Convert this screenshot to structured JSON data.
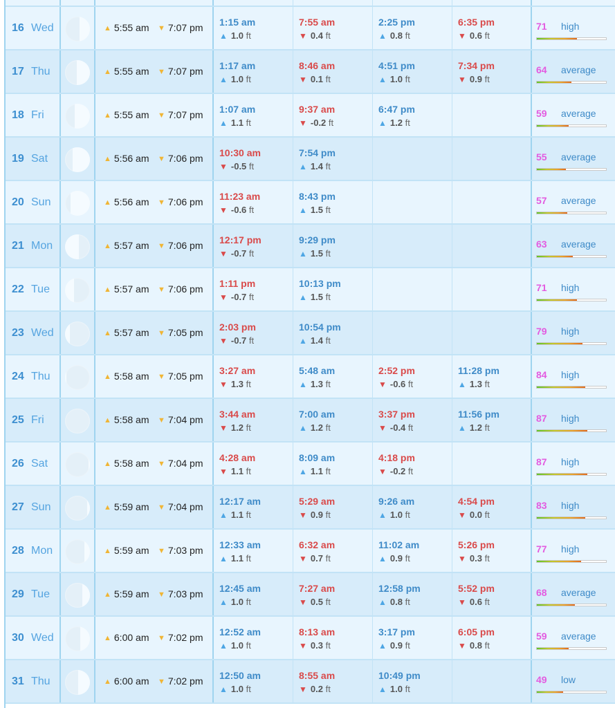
{
  "units": {
    "height": "ft"
  },
  "rows": [
    {
      "day_num": "16",
      "day_name": "Wed",
      "moon_lit": 0.42,
      "moon_side": "right",
      "sunrise": "5:55 am",
      "sunset": "7:07 pm",
      "tides": [
        {
          "time": "1:15 am",
          "type": "high",
          "height": "1.0"
        },
        {
          "time": "7:55 am",
          "type": "low",
          "height": "0.4"
        },
        {
          "time": "2:25 pm",
          "type": "high",
          "height": "0.8"
        },
        {
          "time": "6:35 pm",
          "type": "low",
          "height": "0.6"
        }
      ],
      "coef": "71",
      "coef_label": "high",
      "coef_level": 0.58
    },
    {
      "day_num": "17",
      "day_name": "Thu",
      "moon_lit": 0.52,
      "moon_side": "right",
      "sunrise": "5:55 am",
      "sunset": "7:07 pm",
      "tides": [
        {
          "time": "1:17 am",
          "type": "high",
          "height": "1.0"
        },
        {
          "time": "8:46 am",
          "type": "low",
          "height": "0.1"
        },
        {
          "time": "4:51 pm",
          "type": "high",
          "height": "1.0"
        },
        {
          "time": "7:34 pm",
          "type": "low",
          "height": "0.9"
        }
      ],
      "coef": "64",
      "coef_label": "average",
      "coef_level": 0.5
    },
    {
      "day_num": "18",
      "day_name": "Fri",
      "moon_lit": 0.6,
      "moon_side": "right",
      "sunrise": "5:55 am",
      "sunset": "7:07 pm",
      "tides": [
        {
          "time": "1:07 am",
          "type": "high",
          "height": "1.1"
        },
        {
          "time": "9:37 am",
          "type": "low",
          "height": "-0.2"
        },
        {
          "time": "6:47 pm",
          "type": "high",
          "height": "1.2"
        }
      ],
      "coef": "59",
      "coef_label": "average",
      "coef_level": 0.46
    },
    {
      "day_num": "19",
      "day_name": "Sat",
      "moon_lit": 0.7,
      "moon_side": "right",
      "sunrise": "5:56 am",
      "sunset": "7:06 pm",
      "tides": [
        {
          "time": "10:30 am",
          "type": "low",
          "height": "-0.5"
        },
        {
          "time": "7:54 pm",
          "type": "high",
          "height": "1.4"
        }
      ],
      "coef": "55",
      "coef_label": "average",
      "coef_level": 0.42
    },
    {
      "day_num": "20",
      "day_name": "Sun",
      "moon_lit": 0.78,
      "moon_side": "right",
      "sunrise": "5:56 am",
      "sunset": "7:06 pm",
      "tides": [
        {
          "time": "11:23 am",
          "type": "low",
          "height": "-0.6"
        },
        {
          "time": "8:43 pm",
          "type": "high",
          "height": "1.5"
        }
      ],
      "coef": "57",
      "coef_label": "average",
      "coef_level": 0.44
    },
    {
      "day_num": "21",
      "day_name": "Mon",
      "moon_lit": 0.55,
      "moon_side": "left",
      "sunrise": "5:57 am",
      "sunset": "7:06 pm",
      "tides": [
        {
          "time": "12:17 pm",
          "type": "low",
          "height": "-0.7"
        },
        {
          "time": "9:29 pm",
          "type": "high",
          "height": "1.5"
        }
      ],
      "coef": "63",
      "coef_label": "average",
      "coef_level": 0.52
    },
    {
      "day_num": "22",
      "day_name": "Tue",
      "moon_lit": 0.35,
      "moon_side": "left",
      "sunrise": "5:57 am",
      "sunset": "7:06 pm",
      "tides": [
        {
          "time": "1:11 pm",
          "type": "low",
          "height": "-0.7"
        },
        {
          "time": "10:13 pm",
          "type": "high",
          "height": "1.5"
        }
      ],
      "coef": "71",
      "coef_label": "high",
      "coef_level": 0.58
    },
    {
      "day_num": "23",
      "day_name": "Wed",
      "moon_lit": 0.2,
      "moon_side": "left",
      "sunrise": "5:57 am",
      "sunset": "7:05 pm",
      "tides": [
        {
          "time": "2:03 pm",
          "type": "low",
          "height": "-0.7"
        },
        {
          "time": "10:54 pm",
          "type": "high",
          "height": "1.4"
        }
      ],
      "coef": "79",
      "coef_label": "high",
      "coef_level": 0.66
    },
    {
      "day_num": "24",
      "day_name": "Thu",
      "moon_lit": 0.06,
      "moon_side": "left",
      "sunrise": "5:58 am",
      "sunset": "7:05 pm",
      "tides": [
        {
          "time": "3:27 am",
          "type": "low",
          "height": "1.3"
        },
        {
          "time": "5:48 am",
          "type": "high",
          "height": "1.3"
        },
        {
          "time": "2:52 pm",
          "type": "low",
          "height": "-0.6"
        },
        {
          "time": "11:28 pm",
          "type": "high",
          "height": "1.3"
        }
      ],
      "coef": "84",
      "coef_label": "high",
      "coef_level": 0.7
    },
    {
      "day_num": "25",
      "day_name": "Fri",
      "moon_lit": 0.0,
      "moon_side": "left",
      "sunrise": "5:58 am",
      "sunset": "7:04 pm",
      "tides": [
        {
          "time": "3:44 am",
          "type": "low",
          "height": "1.2"
        },
        {
          "time": "7:00 am",
          "type": "high",
          "height": "1.2"
        },
        {
          "time": "3:37 pm",
          "type": "low",
          "height": "-0.4"
        },
        {
          "time": "11:56 pm",
          "type": "high",
          "height": "1.2"
        }
      ],
      "coef": "87",
      "coef_label": "high",
      "coef_level": 0.73
    },
    {
      "day_num": "26",
      "day_name": "Sat",
      "moon_lit": 0.05,
      "moon_side": "right",
      "sunrise": "5:58 am",
      "sunset": "7:04 pm",
      "tides": [
        {
          "time": "4:28 am",
          "type": "low",
          "height": "1.1"
        },
        {
          "time": "8:09 am",
          "type": "high",
          "height": "1.1"
        },
        {
          "time": "4:18 pm",
          "type": "low",
          "height": "-0.2"
        }
      ],
      "coef": "87",
      "coef_label": "high",
      "coef_level": 0.73
    },
    {
      "day_num": "27",
      "day_name": "Sun",
      "moon_lit": 0.12,
      "moon_side": "right",
      "sunrise": "5:59 am",
      "sunset": "7:04 pm",
      "tides": [
        {
          "time": "12:17 am",
          "type": "high",
          "height": "1.1"
        },
        {
          "time": "5:29 am",
          "type": "low",
          "height": "0.9"
        },
        {
          "time": "9:26 am",
          "type": "high",
          "height": "1.0"
        },
        {
          "time": "4:54 pm",
          "type": "low",
          "height": "0.0"
        }
      ],
      "coef": "83",
      "coef_label": "high",
      "coef_level": 0.7
    },
    {
      "day_num": "28",
      "day_name": "Mon",
      "moon_lit": 0.22,
      "moon_side": "right",
      "sunrise": "5:59 am",
      "sunset": "7:03 pm",
      "tides": [
        {
          "time": "12:33 am",
          "type": "high",
          "height": "1.1"
        },
        {
          "time": "6:32 am",
          "type": "low",
          "height": "0.7"
        },
        {
          "time": "11:02 am",
          "type": "high",
          "height": "0.9"
        },
        {
          "time": "5:26 pm",
          "type": "low",
          "height": "0.3"
        }
      ],
      "coef": "77",
      "coef_label": "high",
      "coef_level": 0.64
    },
    {
      "day_num": "29",
      "day_name": "Tue",
      "moon_lit": 0.3,
      "moon_side": "right",
      "sunrise": "5:59 am",
      "sunset": "7:03 pm",
      "tides": [
        {
          "time": "12:45 am",
          "type": "high",
          "height": "1.0"
        },
        {
          "time": "7:27 am",
          "type": "low",
          "height": "0.5"
        },
        {
          "time": "12:58 pm",
          "type": "high",
          "height": "0.8"
        },
        {
          "time": "5:52 pm",
          "type": "low",
          "height": "0.6"
        }
      ],
      "coef": "68",
      "coef_label": "average",
      "coef_level": 0.55
    },
    {
      "day_num": "30",
      "day_name": "Wed",
      "moon_lit": 0.38,
      "moon_side": "right",
      "sunrise": "6:00 am",
      "sunset": "7:02 pm",
      "tides": [
        {
          "time": "12:52 am",
          "type": "high",
          "height": "1.0"
        },
        {
          "time": "8:13 am",
          "type": "low",
          "height": "0.3"
        },
        {
          "time": "3:17 pm",
          "type": "high",
          "height": "0.9"
        },
        {
          "time": "6:05 pm",
          "type": "low",
          "height": "0.8"
        }
      ],
      "coef": "59",
      "coef_label": "average",
      "coef_level": 0.46
    },
    {
      "day_num": "31",
      "day_name": "Thu",
      "moon_lit": 0.48,
      "moon_side": "right",
      "sunrise": "6:00 am",
      "sunset": "7:02 pm",
      "tides": [
        {
          "time": "12:50 am",
          "type": "high",
          "height": "1.0"
        },
        {
          "time": "8:55 am",
          "type": "low",
          "height": "0.2"
        },
        {
          "time": "10:49 pm",
          "type": "high",
          "height": "1.0"
        }
      ],
      "coef": "49",
      "coef_label": "low",
      "coef_level": 0.38
    }
  ]
}
